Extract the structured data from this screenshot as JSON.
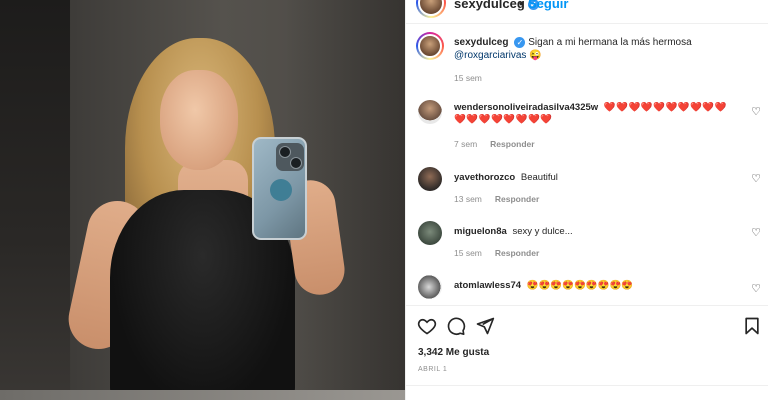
{
  "post": {
    "author": "sexydulceg",
    "follow_label": "Seguir",
    "separator": "•",
    "more_icon": "more-options-icon",
    "more_glyph": "•••",
    "verified_glyph": "✓",
    "caption_user": "sexydulceg",
    "caption_text": "Sigan a mi hermana la más hermosa",
    "caption_mention": "@roxgarciarivas",
    "caption_emoji": "😜",
    "caption_time": "15 sem"
  },
  "comments": [
    {
      "user": "wendersonoliveiradasilva4325w",
      "text": "❤️❤️❤️❤️❤️❤️❤️❤️❤️❤️❤️❤️❤️❤️❤️❤️❤️❤️",
      "time": "7 sem",
      "reply": "Responder"
    },
    {
      "user": "yavethorozco",
      "text": "Beautiful",
      "time": "13 sem",
      "reply": "Responder"
    },
    {
      "user": "miguelon8a",
      "text": "sexy y dulce...",
      "time": "15 sem",
      "reply": "Responder"
    },
    {
      "user": "atomlawless74",
      "text": "😍😍😍😍😍😍😍😍😍",
      "time": "",
      "reply": ""
    }
  ],
  "actions": {
    "like_icon": "heart-icon",
    "comment_icon": "comment-icon",
    "share_icon": "share-icon",
    "save_icon": "bookmark-icon",
    "likes_text": "3,342 Me gusta",
    "date_text": "ABRIL 1"
  },
  "colors": {
    "accent": "#0095f6",
    "muted": "#8e8e8e",
    "verified": "#3897f0"
  }
}
